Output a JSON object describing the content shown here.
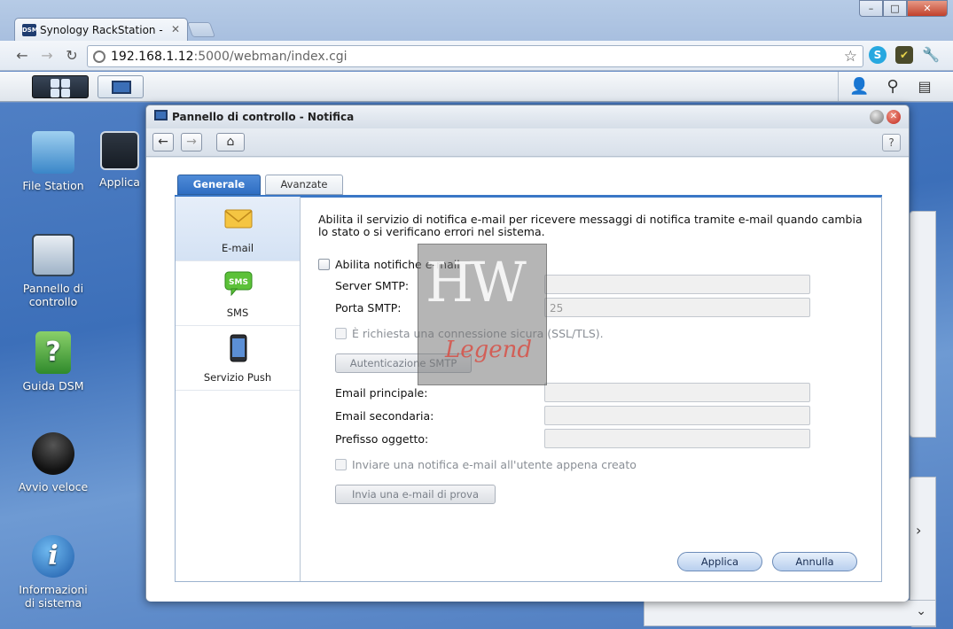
{
  "browser": {
    "tab_title": "Synology RackStation - Rac",
    "tab_favicon_text": "DSM",
    "url_host": "192.168.1.12",
    "url_rest": ":5000/webman/index.cgi"
  },
  "desktop": {
    "icons": [
      {
        "label": "File Station"
      },
      {
        "label": "Applica"
      },
      {
        "label": "Pannello di controllo"
      },
      {
        "label": "Guida DSM"
      },
      {
        "label": "Avvio veloce"
      },
      {
        "label": "Informazioni di sistema"
      }
    ]
  },
  "window": {
    "title": "Pannello di controllo - Notifica",
    "help": "?"
  },
  "tabs": {
    "general": "Generale",
    "advanced": "Avanzate"
  },
  "sidebar": {
    "items": [
      {
        "label": "E-mail",
        "selected": true
      },
      {
        "label": "SMS",
        "icon_text": "SMS"
      },
      {
        "label": "Servizio Push"
      }
    ]
  },
  "email": {
    "description": "Abilita il servizio di notifica e-mail per ricevere messaggi di notifica tramite e-mail quando cambia lo stato o si verificano errori nel sistema.",
    "enable_label": "Abilita notifiche e-mail",
    "smtp_server_label": "Server SMTP:",
    "smtp_server_value": "",
    "smtp_port_label": "Porta SMTP:",
    "smtp_port_value": "25",
    "ssl_label": "È richiesta una connessione sicura (SSL/TLS).",
    "auth_button": "Autenticazione SMTP",
    "primary_label": "Email principale:",
    "secondary_label": "Email secondaria:",
    "subject_label": "Prefisso oggetto:",
    "notify_user_label": "Inviare una notifica e-mail all'utente appena creato",
    "test_button": "Invia una e-mail di prova"
  },
  "actions": {
    "apply": "Applica",
    "cancel": "Annulla"
  },
  "watermark": {
    "line1": "HW",
    "line2": "Legend"
  }
}
